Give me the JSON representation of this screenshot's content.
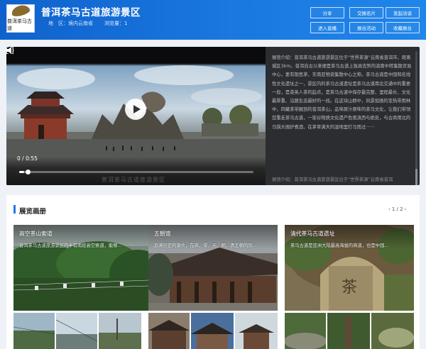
{
  "header": {
    "logo_text": "普洱茶马古道",
    "title": "普洱茶马古道旅游景区",
    "location": "地　区：境内云南省",
    "views": "浏览量：1",
    "buttons": {
      "share": "分享",
      "exchange_card": "交换名片",
      "invite": "发起洽谈",
      "enter_exhibit": "进入直播",
      "exhibit_activity": "展台活动",
      "favorite": "收藏展台"
    },
    "colors": {
      "header_start": "#0f62cc",
      "header_end": "#1f86ea"
    }
  },
  "video": {
    "time": "0 / 0:55",
    "progress_fraction": 0.02,
    "caption_ghost": "普洱茶马古道旅游景区"
  },
  "intro": {
    "text": "展馆介绍：普洱茶马古道旅游景区位于“世界茶源”云南省普洱市，距离城区3km。普洱自古以来便是茶马古道上独具优势的滇南中转集散贸易中心，素有银思茅、东南亚物资集散中心之称。茶马古道是中国知名线性文化遗址之一，景区内的茶马古道遗址是茶马古道南北交通中的重要一段，是昔英人茶的起点，是茶马古道中保存最完整、里程最长、文化最厚重、沿路生态最好的一段。在这块山群中，风景如画的亚热带雨林中，四藏茶带圈到的普洱茶山，品味原汁原味的茶马文化，让我们带领您重走茶马古道，一架谷物质文化遗产色雨滇西与绝处，与古商用北的马锅头围炉煮酒，在茅草满天的湿地里打马而过······",
    "next": "展馆介绍：普洱茶马古道旅游景区位于“世界茶源”云南省普洱"
  },
  "album": {
    "title": "展览画册",
    "pager": "1 / 2",
    "cards": [
      {
        "title": "高空茶山索道",
        "desc": "普洱茶马古道旅游景区内半有南段高空索道，能够..."
      },
      {
        "title": "五朝馆",
        "desc": "追溯历史的源头，在商、宋、元、明、清五朝的历..."
      },
      {
        "title": "清代茶马古道遗址",
        "desc": "茶马古道是亚洲大陆最高海拔的商道，也是中国..."
      }
    ]
  }
}
